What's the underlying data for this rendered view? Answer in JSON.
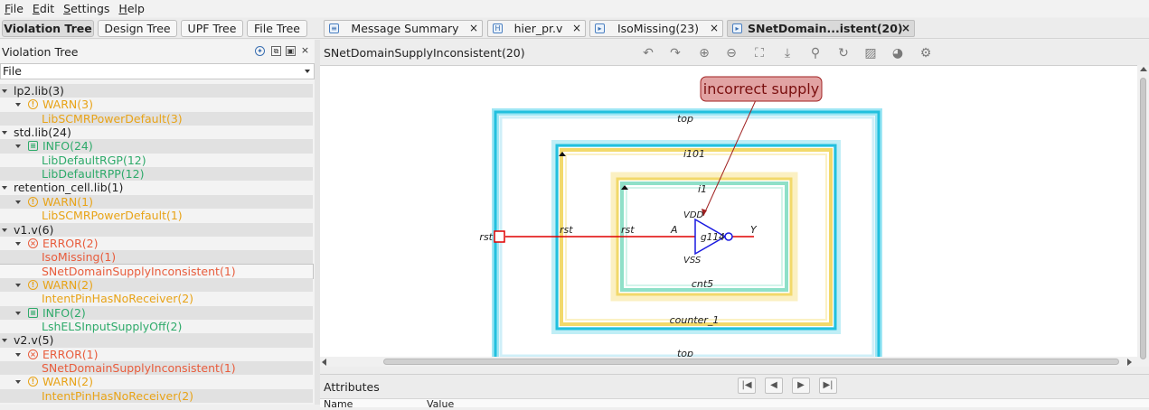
{
  "menu": [
    {
      "label": "File",
      "u": "F",
      "rest": "ile"
    },
    {
      "label": "Edit",
      "u": "E",
      "rest": "dit"
    },
    {
      "label": "Settings",
      "u": "S",
      "rest": "ettings"
    },
    {
      "label": "Help",
      "u": "H",
      "rest": "elp"
    }
  ],
  "view_tabs": [
    "Violation Tree",
    "Design Tree",
    "UPF Tree",
    "File Tree"
  ],
  "doc_tabs": [
    {
      "label": "Message Summary",
      "icon": "message-icon",
      "close": "×"
    },
    {
      "label": "hier_pr.v",
      "icon": "verilog-file-icon",
      "close": "×"
    },
    {
      "label": "IsoMissing(23)",
      "icon": "schematic-icon",
      "close": "×"
    },
    {
      "label": "SNetDomain...istent(20)",
      "icon": "schematic-icon",
      "close": "×"
    }
  ],
  "left_panel": {
    "title": "Violation Tree",
    "filter_value": "File"
  },
  "tree": [
    {
      "level": 0,
      "label": "lp2.lib(3)",
      "expanded": true,
      "color": "#222222"
    },
    {
      "level": 1,
      "label": "WARN(3)",
      "severity": "warn",
      "expanded": true,
      "color": "#e8a317"
    },
    {
      "level": 2,
      "label": "LibSCMRPowerDefault(3)",
      "color": "#e8a317"
    },
    {
      "level": 0,
      "label": "std.lib(24)",
      "expanded": true,
      "color": "#222222"
    },
    {
      "level": 1,
      "label": "INFO(24)",
      "severity": "info",
      "expanded": true,
      "color": "#2eaa6a"
    },
    {
      "level": 2,
      "label": "LibDefaultRGP(12)",
      "color": "#2eaa6a"
    },
    {
      "level": 2,
      "label": "LibDefaultRPP(12)",
      "color": "#2eaa6a"
    },
    {
      "level": 0,
      "label": "retention_cell.lib(1)",
      "expanded": true,
      "color": "#222222"
    },
    {
      "level": 1,
      "label": "WARN(1)",
      "severity": "warn",
      "expanded": true,
      "color": "#e8a317"
    },
    {
      "level": 2,
      "label": "LibSCMRPowerDefault(1)",
      "color": "#e8a317"
    },
    {
      "level": 0,
      "label": "v1.v(6)",
      "expanded": true,
      "color": "#222222"
    },
    {
      "level": 1,
      "label": "ERROR(2)",
      "severity": "error",
      "expanded": true,
      "color": "#e85c3c"
    },
    {
      "level": 2,
      "label": "IsoMissing(1)",
      "color": "#e85c3c"
    },
    {
      "level": 2,
      "label": "SNetDomainSupplyInconsistent(1)",
      "color": "#e85c3c",
      "selected": true
    },
    {
      "level": 1,
      "label": "WARN(2)",
      "severity": "warn",
      "expanded": true,
      "color": "#e8a317"
    },
    {
      "level": 2,
      "label": "IntentPinHasNoReceiver(2)",
      "color": "#e8a317"
    },
    {
      "level": 1,
      "label": "INFO(2)",
      "severity": "info",
      "expanded": true,
      "color": "#2eaa6a"
    },
    {
      "level": 2,
      "label": "LshELSInputSupplyOff(2)",
      "color": "#2eaa6a"
    },
    {
      "level": 0,
      "label": "v2.v(5)",
      "expanded": true,
      "color": "#222222"
    },
    {
      "level": 1,
      "label": "ERROR(1)",
      "severity": "error",
      "expanded": true,
      "color": "#e85c3c"
    },
    {
      "level": 2,
      "label": "SNetDomainSupplyInconsistent(1)",
      "color": "#e85c3c"
    },
    {
      "level": 1,
      "label": "WARN(2)",
      "severity": "warn",
      "expanded": true,
      "color": "#e8a317"
    },
    {
      "level": 2,
      "label": "IntentPinHasNoReceiver(2)",
      "color": "#e8a317"
    }
  ],
  "severity_glyphs": {
    "warn": "!",
    "error": "×",
    "info": "≡"
  },
  "view": {
    "title": "SNetDomainSupplyInconsistent(20)",
    "toolbar": [
      "undo-icon",
      "redo-icon",
      "zoom-in-icon",
      "zoom-out-icon",
      "fit-icon",
      "download-icon",
      "search-icon",
      "refresh-icon",
      "hatch-icon",
      "palette-icon",
      "gear-icon"
    ],
    "toolbar_glyphs": [
      "↶",
      "↷",
      "⊕",
      "⊖",
      "⛶",
      "⤓",
      "⚲",
      "↻",
      "▨",
      "◕",
      "⚙"
    ]
  },
  "schematic": {
    "callout": "incorrect supply",
    "block_top": "top",
    "block_top_bottom": "top",
    "block_i101": "i101",
    "block_counter": "counter_1",
    "block_i1": "i1",
    "block_cnt5": "cnt5",
    "port_outer": "rst",
    "port_mid": "rst",
    "port_inner": "rst",
    "pin_a": "A",
    "pin_y": "Y",
    "pin_vdd": "VDD",
    "pin_vss": "VSS",
    "cell": "g114",
    "colors": {
      "outer": "#22c0de",
      "middle": "#f2d96a",
      "inner": "#8fe0c8",
      "net": "#e00000",
      "cell": "#1a1ae0",
      "callout_fill": "#e2a3a3"
    }
  },
  "attributes": {
    "title": "Attributes",
    "nav": [
      "|◀",
      "◀",
      "▶",
      "▶|"
    ],
    "col_name": "Name",
    "col_value": "Value"
  }
}
